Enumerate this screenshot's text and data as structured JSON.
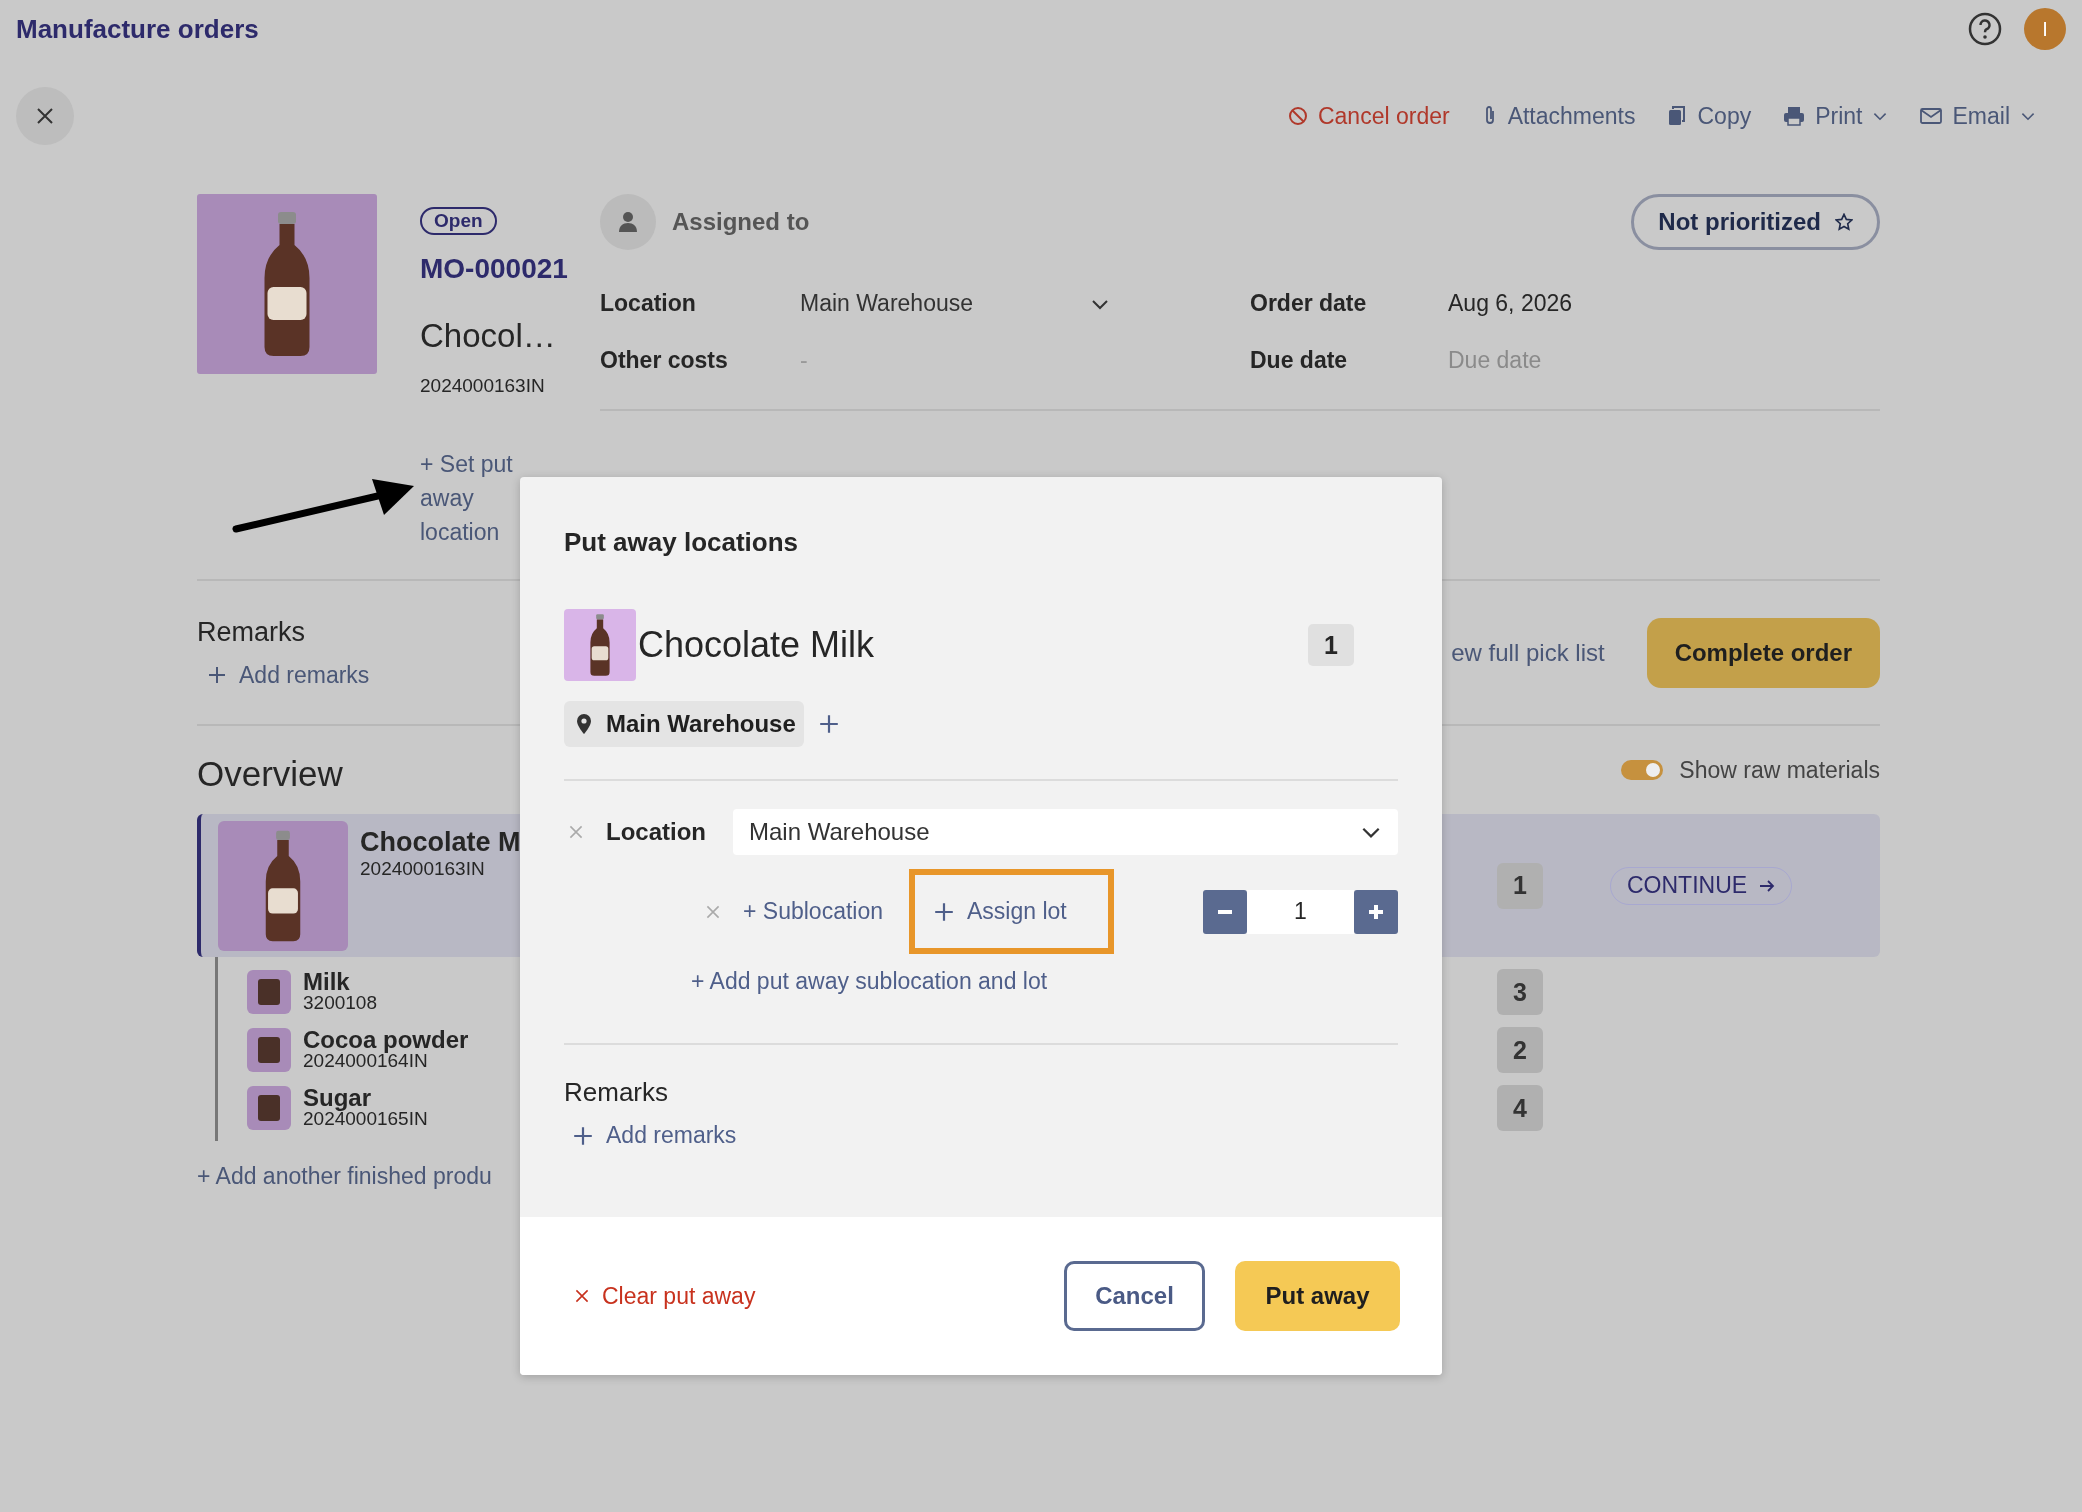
{
  "header": {
    "title": "Manufacture orders",
    "avatar_initial": "I"
  },
  "toolbar": {
    "actions": [
      {
        "label": "Cancel order",
        "kind": "cancel",
        "has_menu": false
      },
      {
        "label": "Attachments",
        "kind": "attach",
        "has_menu": false
      },
      {
        "label": "Copy",
        "kind": "copy",
        "has_menu": false
      },
      {
        "label": "Print",
        "kind": "print",
        "has_menu": true
      },
      {
        "label": "Email",
        "kind": "email",
        "has_menu": true
      }
    ]
  },
  "order": {
    "status": "Open",
    "number": "MO-000021",
    "product": "Chocol…",
    "batch": "2024000163IN",
    "assigned_to": "Assigned to",
    "priority": "Not prioritized",
    "put_away_link": "+ Set put away location",
    "fields": [
      {
        "label": "Location",
        "value": "Main Warehouse",
        "kind": "select"
      },
      {
        "label": "Order date",
        "value": "Aug 6, 2026",
        "kind": "text"
      },
      {
        "label": "Other costs",
        "value": "-",
        "kind": "muted"
      },
      {
        "label": "Due date",
        "placeholder": "Due date",
        "kind": "date"
      }
    ]
  },
  "remarks": {
    "title": "Remarks",
    "add": "Add remarks"
  },
  "pick_list_link": "ew full pick list",
  "complete_button": "Complete order",
  "overview": {
    "title": "Overview",
    "toggle": {
      "label": "Show raw materials",
      "on": true
    },
    "product": {
      "name": "Chocolate M",
      "code": "2024000163IN",
      "quantity": "1",
      "action": "CONTINUE",
      "selected": true
    },
    "materials": [
      {
        "name": "Milk",
        "code": "3200108",
        "quantity": "3"
      },
      {
        "name": "Cocoa powder",
        "code": "2024000164IN",
        "quantity": "2"
      },
      {
        "name": "Sugar",
        "code": "2024000165IN",
        "quantity": "4"
      }
    ],
    "add_link": "+ Add another finished produ"
  },
  "dialog": {
    "title": "Put away locations",
    "product": {
      "name": "Chocolate Milk",
      "quantity": "1"
    },
    "location_chip": "Main Warehouse",
    "location_label": "Location",
    "location_value": "Main Warehouse",
    "sublocation_link": "+ Sublocation",
    "assign_lot": {
      "label": "Assign lot",
      "highlighted": true
    },
    "quantity": "1",
    "add_line_link": "+ Add put away sublocation and lot",
    "remarks_title": "Remarks",
    "add_remarks": "Add remarks",
    "clear": "Clear put away",
    "cancel": "Cancel",
    "submit": "Put away"
  }
}
